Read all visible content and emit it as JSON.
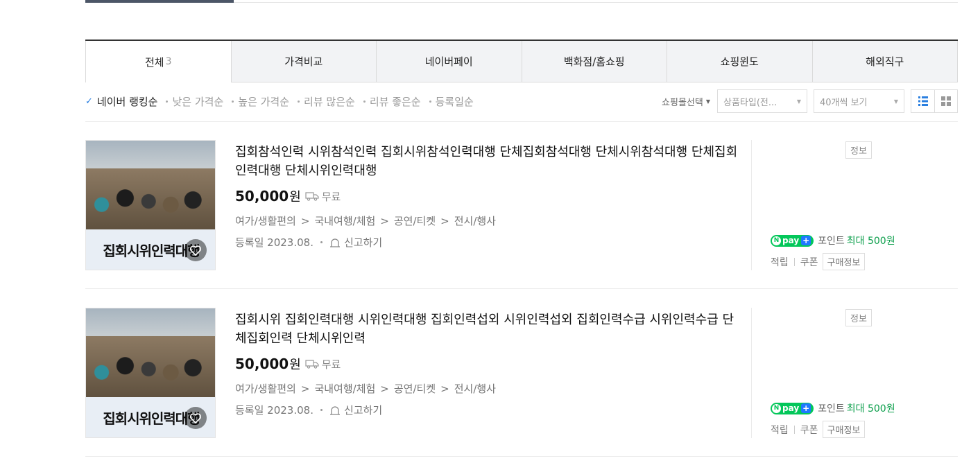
{
  "tabs": [
    {
      "label": "전체",
      "count": "3"
    },
    {
      "label": "가격비교",
      "count": ""
    },
    {
      "label": "네이버페이",
      "count": ""
    },
    {
      "label": "백화점/홈쇼핑",
      "count": ""
    },
    {
      "label": "쇼핑윈도",
      "count": ""
    },
    {
      "label": "해외직구",
      "count": ""
    }
  ],
  "sort": {
    "options": [
      "네이버 랭킹순",
      "낮은 가격순",
      "높은 가격순",
      "리뷰 많은순",
      "리뷰 좋은순",
      "등록일순"
    ],
    "active_index": 0,
    "mall_select": "쇼핑몰선택",
    "product_type": "상품타입(전...",
    "page_size": "40개씩 보기",
    "view_mode": "list"
  },
  "items": [
    {
      "title": "집회참석인력 시위참석인력 집회시위참석인력대행 단체집회참석대행 단체시위참석대행 단체집회인력대행 단체시위인력대행",
      "price": "50,000",
      "currency": "원",
      "delivery": "무료",
      "category": [
        "여가/생활편의",
        "국내여행/체험",
        "공연/티켓",
        "전시/행사"
      ],
      "registered": "등록일 2023.08.",
      "report": "신고하기",
      "thumb_caption": "집회시위인력대행",
      "info_badge": "정보",
      "npay_point_label": "포인트",
      "npay_point_value": "최대 500원",
      "benefit_accrue": "적립",
      "benefit_coupon": "쿠폰",
      "purchase_info": "구매정보"
    },
    {
      "title": "집회시위 집회인력대행 시위인력대행 집회인력섭외 시위인력섭외 집회인력수급 시위인력수급 단체집회인력 단체시위인력",
      "price": "50,000",
      "currency": "원",
      "delivery": "무료",
      "category": [
        "여가/생활편의",
        "국내여행/체험",
        "공연/티켓",
        "전시/행사"
      ],
      "registered": "등록일 2023.08.",
      "report": "신고하기",
      "thumb_caption": "집회시위인력대행",
      "info_badge": "정보",
      "npay_point_label": "포인트",
      "npay_point_value": "최대 500원",
      "benefit_accrue": "적립",
      "benefit_coupon": "쿠폰",
      "purchase_info": "구매정보"
    }
  ],
  "npay_label": "pay",
  "colors": {
    "accent": "#2a7fe0",
    "npay_green": "#03c75a",
    "point_green": "#0a9e4a",
    "tab_bg": "#f2f3f5"
  }
}
